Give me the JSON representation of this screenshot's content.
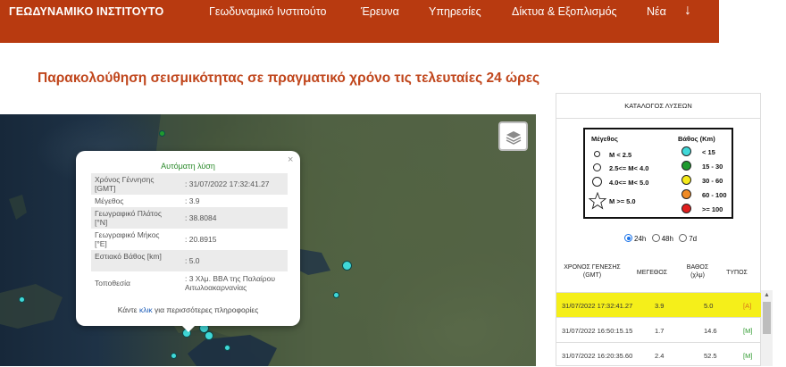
{
  "header": {
    "logo": "ΓΕΩΔΥΝΑΜΙΚΟ ΙΝΣΤΙΤΟΥΤΟ",
    "nav": [
      "Γεωδυναμικό Ινστιτούτο",
      "Έρευνα",
      "Υπηρεσίες",
      "Δίκτυα & Εξοπλισμός",
      "Νέα"
    ],
    "arrow": "↓",
    "color": "#b83a10"
  },
  "page_title": "Παρακολούθηση σεισμικότητας σε πραγματικό χρόνο τις τελευταίες 24 ώρες",
  "map": {
    "layers_icon": "layers-icon"
  },
  "popup": {
    "close": "×",
    "title": "Αυτόματη λύση",
    "rows": [
      {
        "key": "Χρόνος Γέννησης [GMT]",
        "value": ": 31/07/2022 17:32:41.27"
      },
      {
        "key": "Μέγεθος",
        "value": ": 3.9"
      },
      {
        "key": "Γεωγραφικό Πλάτος [°N]",
        "value": ": 38.8084"
      },
      {
        "key": "Γεωγραφικό Μήκος [°E]",
        "value": ": 20.8915"
      },
      {
        "key": "Εστιακό Βάθος [km]",
        "value": ": 5.0"
      },
      {
        "key": "Τοποθεσία",
        "value": ": 3 Χλμ. ΒΒΑ της Παλαίρου Αιτωλοακαρνανίας"
      }
    ],
    "footer_pre": "Κάντε ",
    "footer_link": "κλικ",
    "footer_post": " για περισσότερες πληροφορίες"
  },
  "panel": {
    "heading": "ΚΑΤΑΛΟΓΟΣ ΛΥΣΕΩΝ",
    "legend": {
      "magnitude_title": "Μέγεθος",
      "magnitudes": [
        "M < 2.5",
        "2.5<= M< 4.0",
        "4.0<= M< 5.0",
        "M >= 5.0"
      ],
      "depth_title": "Βάθος (Km)",
      "depths": [
        {
          "label": "< 15",
          "color": "#40d8d8"
        },
        {
          "label": "15 - 30",
          "color": "#1f9a2e"
        },
        {
          "label": "30 - 60",
          "color": "#f5ea1a"
        },
        {
          "label": "60 - 100",
          "color": "#f08a24"
        },
        {
          "label": ">= 100",
          "color": "#e01e1e"
        }
      ]
    },
    "ranges": [
      {
        "label": "24h",
        "selected": true
      },
      {
        "label": "48h",
        "selected": false
      },
      {
        "label": "7d",
        "selected": false
      }
    ],
    "columns": {
      "time": "ΧΡΟΝΟΣ ΓΕΝΕΣΗΣ (GMT)",
      "magnitude": "ΜΕΓΕΘΟΣ",
      "depth": "ΒΑΘΟΣ (χλμ)",
      "type": "ΤΥΠΟΣ"
    },
    "events": [
      {
        "time": "31/07/2022 17:32:41.27",
        "magnitude": "3.9",
        "depth": "5.0",
        "type": "[A]",
        "selected": true
      },
      {
        "time": "31/07/2022 16:50:15.15",
        "magnitude": "1.7",
        "depth": "14.6",
        "type": "[M]",
        "selected": false
      },
      {
        "time": "31/07/2022 16:20:35.60",
        "magnitude": "2.4",
        "depth": "52.5",
        "type": "[M]",
        "selected": false
      }
    ],
    "type_colors": {
      "A": "#d8731b",
      "M": "#2e9a2e"
    },
    "scroll_up": "▲"
  }
}
